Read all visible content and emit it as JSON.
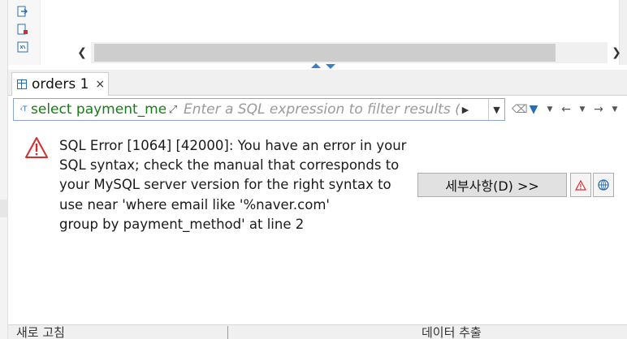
{
  "result_tab": {
    "label": "orders 1",
    "close_glyph": "×"
  },
  "filter": {
    "query_preview": "select payment_met",
    "placeholder": "Enter a SQL expression to filter results (use Ctrl+Space)"
  },
  "error": {
    "lines": [
      "SQL Error [1064] [42000]: You have an error in your",
      "SQL syntax; check the manual that corresponds to",
      "your MySQL server version for the right syntax to",
      "use near 'where email like '%naver.com'",
      "group by payment_method' at line 2"
    ],
    "details_button": "세부사항(D) >>"
  },
  "bottom_bar": {
    "left_text": "새로 고침",
    "right_text": "데이터 추출"
  },
  "colors": {
    "error_red": "#d62c2c",
    "accent_blue": "#2b6cb0",
    "query_green": "#1b7a1b"
  }
}
